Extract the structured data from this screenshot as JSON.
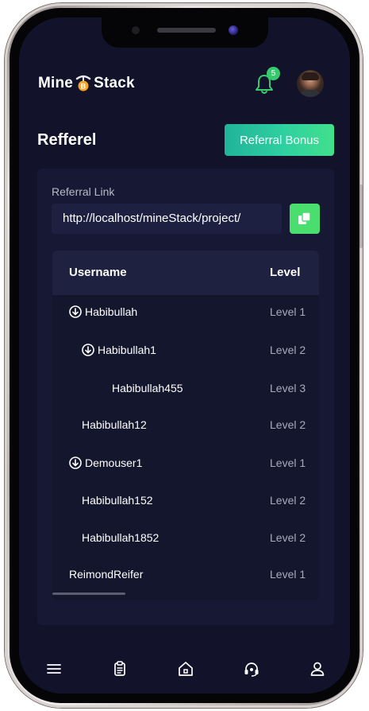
{
  "header": {
    "logo_left": "Mine",
    "logo_right": "Stack",
    "notification_count": "5"
  },
  "page": {
    "title": "Refferel",
    "bonus_button": "Referral Bonus"
  },
  "referral": {
    "label": "Referral Link",
    "link": "http://localhost/mineStack/project/"
  },
  "table": {
    "headers": {
      "username": "Username",
      "level": "Level"
    },
    "rows": [
      {
        "username": "Habibullah",
        "level": "Level 1",
        "expandable": true
      },
      {
        "username": "Habibullah1",
        "level": "Level 2",
        "expandable": true
      },
      {
        "username": "Habibullah455",
        "level": "Level 3",
        "expandable": false
      },
      {
        "username": "Habibullah12",
        "level": "Level 2",
        "expandable": false
      },
      {
        "username": "Demouser1",
        "level": "Level 1",
        "expandable": true
      },
      {
        "username": "Habibullah152",
        "level": "Level 2",
        "expandable": false
      },
      {
        "username": "Habibullah1852",
        "level": "Level 2",
        "expandable": false
      },
      {
        "username": "ReimondReifer",
        "level": "Level 1",
        "expandable": false
      }
    ]
  },
  "bottom_nav": {
    "items": [
      "menu-icon",
      "clipboard-icon",
      "home-icon",
      "support-headset-icon",
      "user-icon"
    ]
  },
  "colors": {
    "background": "#12132b",
    "card": "#171934",
    "accent_green": "#36c96e",
    "bonus_gradient_start": "#21b39a",
    "bonus_gradient_end": "#41e08c"
  }
}
